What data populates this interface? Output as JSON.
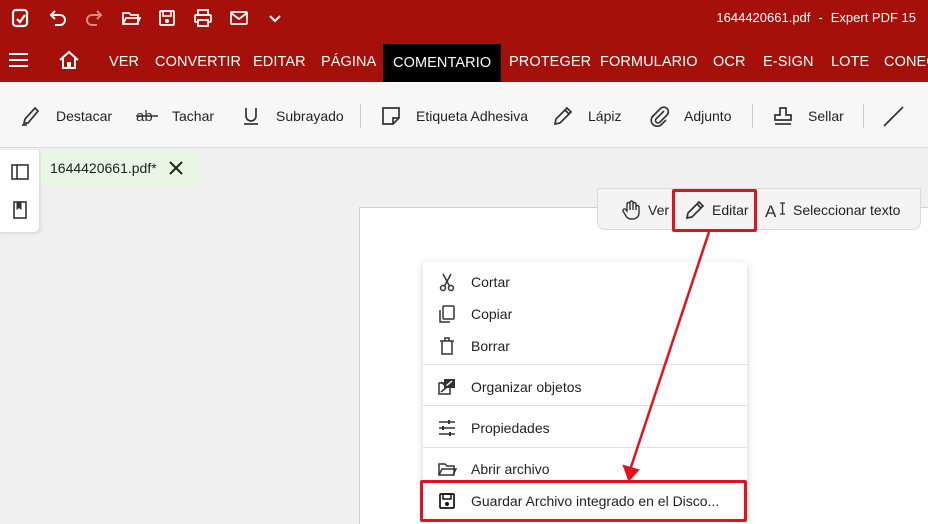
{
  "titlebar": {
    "filename": "1644420661.pdf",
    "separator": "-",
    "app_name": "Expert PDF 15",
    "icons": [
      "app-logo-icon",
      "undo-icon",
      "redo-icon",
      "open-folder-icon",
      "save-icon",
      "print-icon",
      "mail-icon",
      "chevron-down-icon"
    ]
  },
  "menu": {
    "items": [
      "VER",
      "CONVERTIR",
      "EDITAR",
      "PÁGINA",
      "COMENTARIO",
      "PROTEGER",
      "FORMULARIO",
      "OCR",
      "E-SIGN",
      "LOTE",
      "CONEC"
    ],
    "active": "COMENTARIO"
  },
  "toolbar": {
    "highlight": "Destacar",
    "strikeout": "Tachar",
    "underline": "Subrayado",
    "sticky_note": "Etiqueta Adhesiva",
    "pencil": "Lápiz",
    "attachment": "Adjunto",
    "stamp": "Sellar"
  },
  "doc_tab": {
    "name": "1644420661.pdf*"
  },
  "mode_bar": {
    "view": "Ver",
    "edit": "Editar",
    "select_text": "Seleccionar texto"
  },
  "context_menu": {
    "cut": "Cortar",
    "copy": "Copiar",
    "delete": "Borrar",
    "arrange": "Organizar objetos",
    "properties": "Propiedades",
    "open_file": "Abrir archivo",
    "save_embedded": "Guardar Archivo integrado en el Disco..."
  },
  "colors": {
    "brand_red": "#a5110a",
    "highlight_red": "#e0131e",
    "active_tab_bg": "#000000",
    "doc_tab_bg": "#e7f7e3"
  }
}
